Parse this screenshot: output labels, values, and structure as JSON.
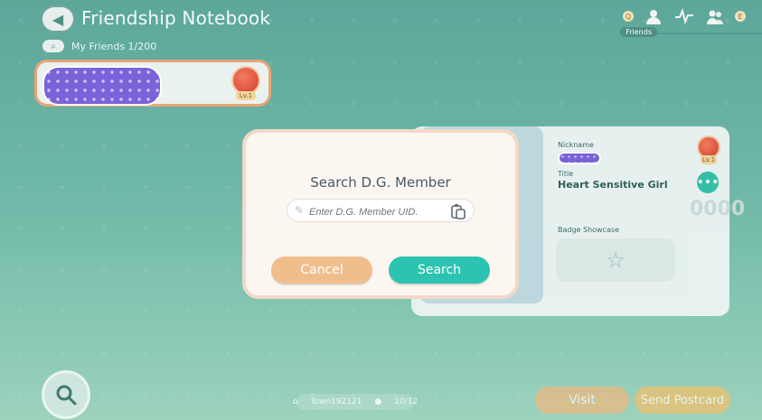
{
  "header": {
    "back_icon": "chevron-left-icon",
    "title": "Friendship Notebook",
    "friends_tab_label": "Friends",
    "top_badges": [
      "Q",
      "E"
    ]
  },
  "friends": {
    "count_text": "My Friends 1/200",
    "list": [
      {
        "level": "Lv.1"
      }
    ]
  },
  "profile": {
    "nickname_label": "Nickname",
    "title_label": "Title",
    "title_value": "Heart Sensitive Girl",
    "badge_showcase_label": "Badge Showcase",
    "level": "Lv.1",
    "vertical_code": "0000"
  },
  "dialog": {
    "title": "Search D.G. Member",
    "placeholder": "Enter D.G. Member UID.",
    "cancel_label": "Cancel",
    "search_label": "Search"
  },
  "bottom": {
    "status_left": "Town192121",
    "status_right": "10/12",
    "visit_label": "Visit",
    "send_postcard_label": "Send Postcard"
  },
  "colors": {
    "accent": "#2cc3b0",
    "cancel": "#f0bd8d",
    "friend_border": "#e9a474",
    "nickname_purple": "#7a62d8"
  }
}
